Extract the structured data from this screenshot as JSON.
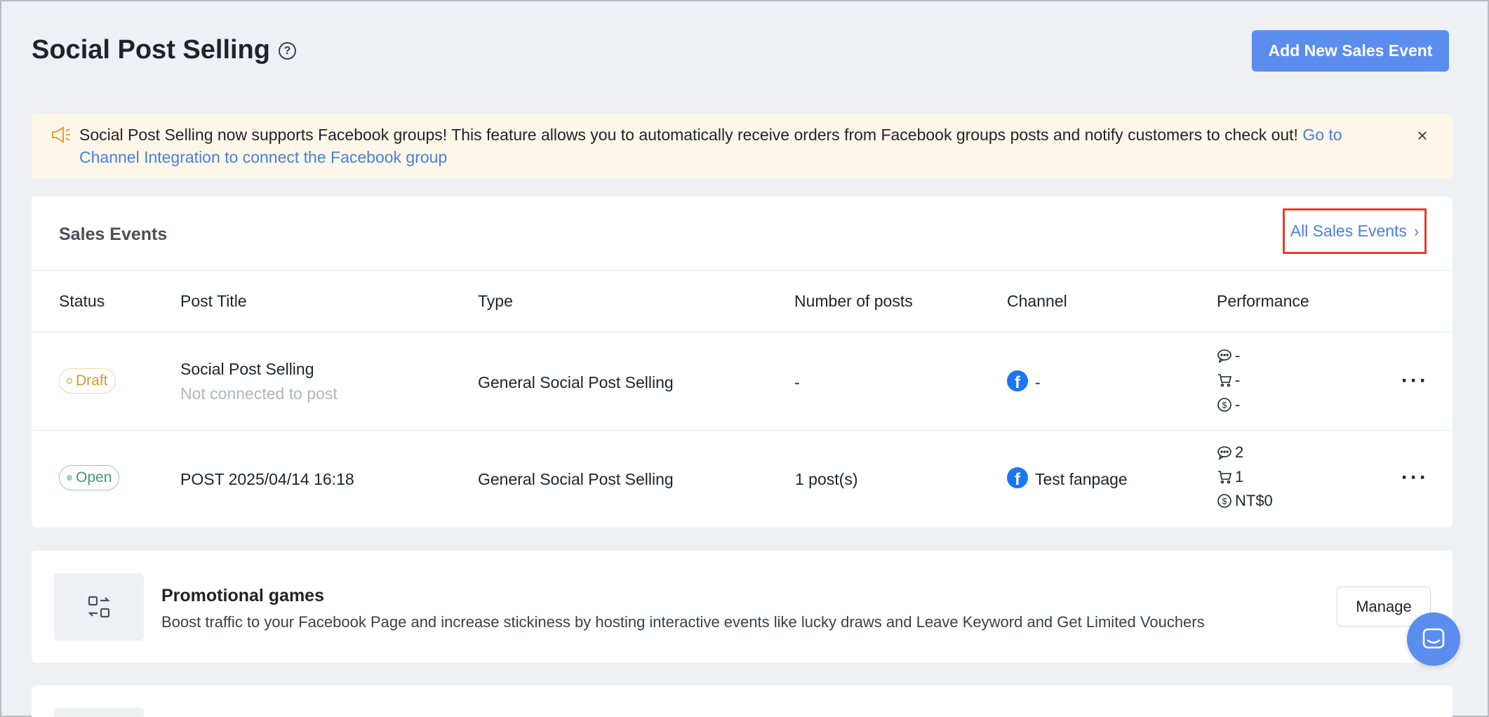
{
  "header": {
    "title": "Social Post Selling",
    "help_icon": "question-circle-icon",
    "add_button_label": "Add New Sales Event"
  },
  "banner": {
    "icon": "megaphone-icon",
    "text": "Social Post Selling now supports Facebook groups! This feature allows you to automatically receive orders from Facebook groups posts and notify customers to check out! ",
    "link_text": "Go to Channel Integration to connect the Facebook group",
    "close_icon": "close-icon"
  },
  "sales_events": {
    "title": "Sales Events",
    "all_link_label": "All Sales Events",
    "columns": [
      "Status",
      "Post Title",
      "Type",
      "Number of posts",
      "Channel",
      "Performance"
    ],
    "rows": [
      {
        "status": "Draft",
        "post_title": "Social Post Selling",
        "post_subtitle": "Not connected to post",
        "type": "General Social Post Selling",
        "num_posts": "-",
        "channel": "-",
        "perf_comments": "-",
        "perf_orders": "-",
        "perf_revenue": "-"
      },
      {
        "status": "Open",
        "post_title": "POST 2025/04/14 16:18",
        "post_subtitle": "",
        "type": "General Social Post Selling",
        "num_posts": "1 post(s)",
        "channel": "Test fanpage",
        "perf_comments": "2",
        "perf_orders": "1",
        "perf_revenue": "NT$0"
      }
    ]
  },
  "promo": {
    "title": "Promotional games",
    "description": "Boost traffic to your Facebook Page and increase stickiness by hosting interactive events like lucky draws and Leave Keyword and Get Limited Vouchers",
    "button_label": "Manage"
  },
  "colors": {
    "accent": "#5b8def",
    "highlight_border": "#e53c2e",
    "banner_bg": "#fdf7e9",
    "draft": "#d29a2b",
    "open": "#3c9b6a"
  }
}
